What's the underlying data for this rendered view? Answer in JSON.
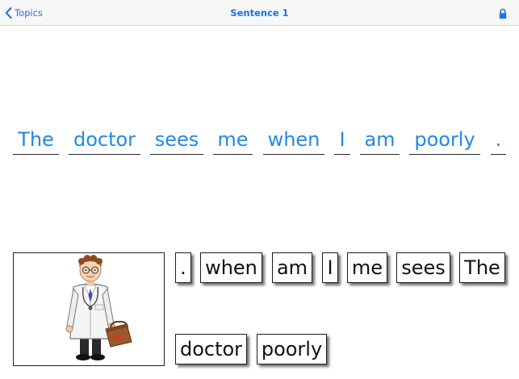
{
  "navbar": {
    "back_label": "Topics",
    "title": "Sentence 1"
  },
  "icons": {
    "back": "chevron-left-icon",
    "lock": "lock-icon"
  },
  "colors": {
    "accent": "#1a73e8",
    "sentence_text": "#2189e8"
  },
  "sentence": {
    "slots": [
      "The",
      "doctor",
      "sees",
      "me",
      "when",
      "I",
      "am",
      "poorly",
      "."
    ]
  },
  "picture": {
    "subject": "doctor with medical bag"
  },
  "word_bank": {
    "tiles": [
      ".",
      "when",
      "am",
      "I",
      "me",
      "sees",
      "The",
      "doctor",
      "poorly"
    ]
  }
}
